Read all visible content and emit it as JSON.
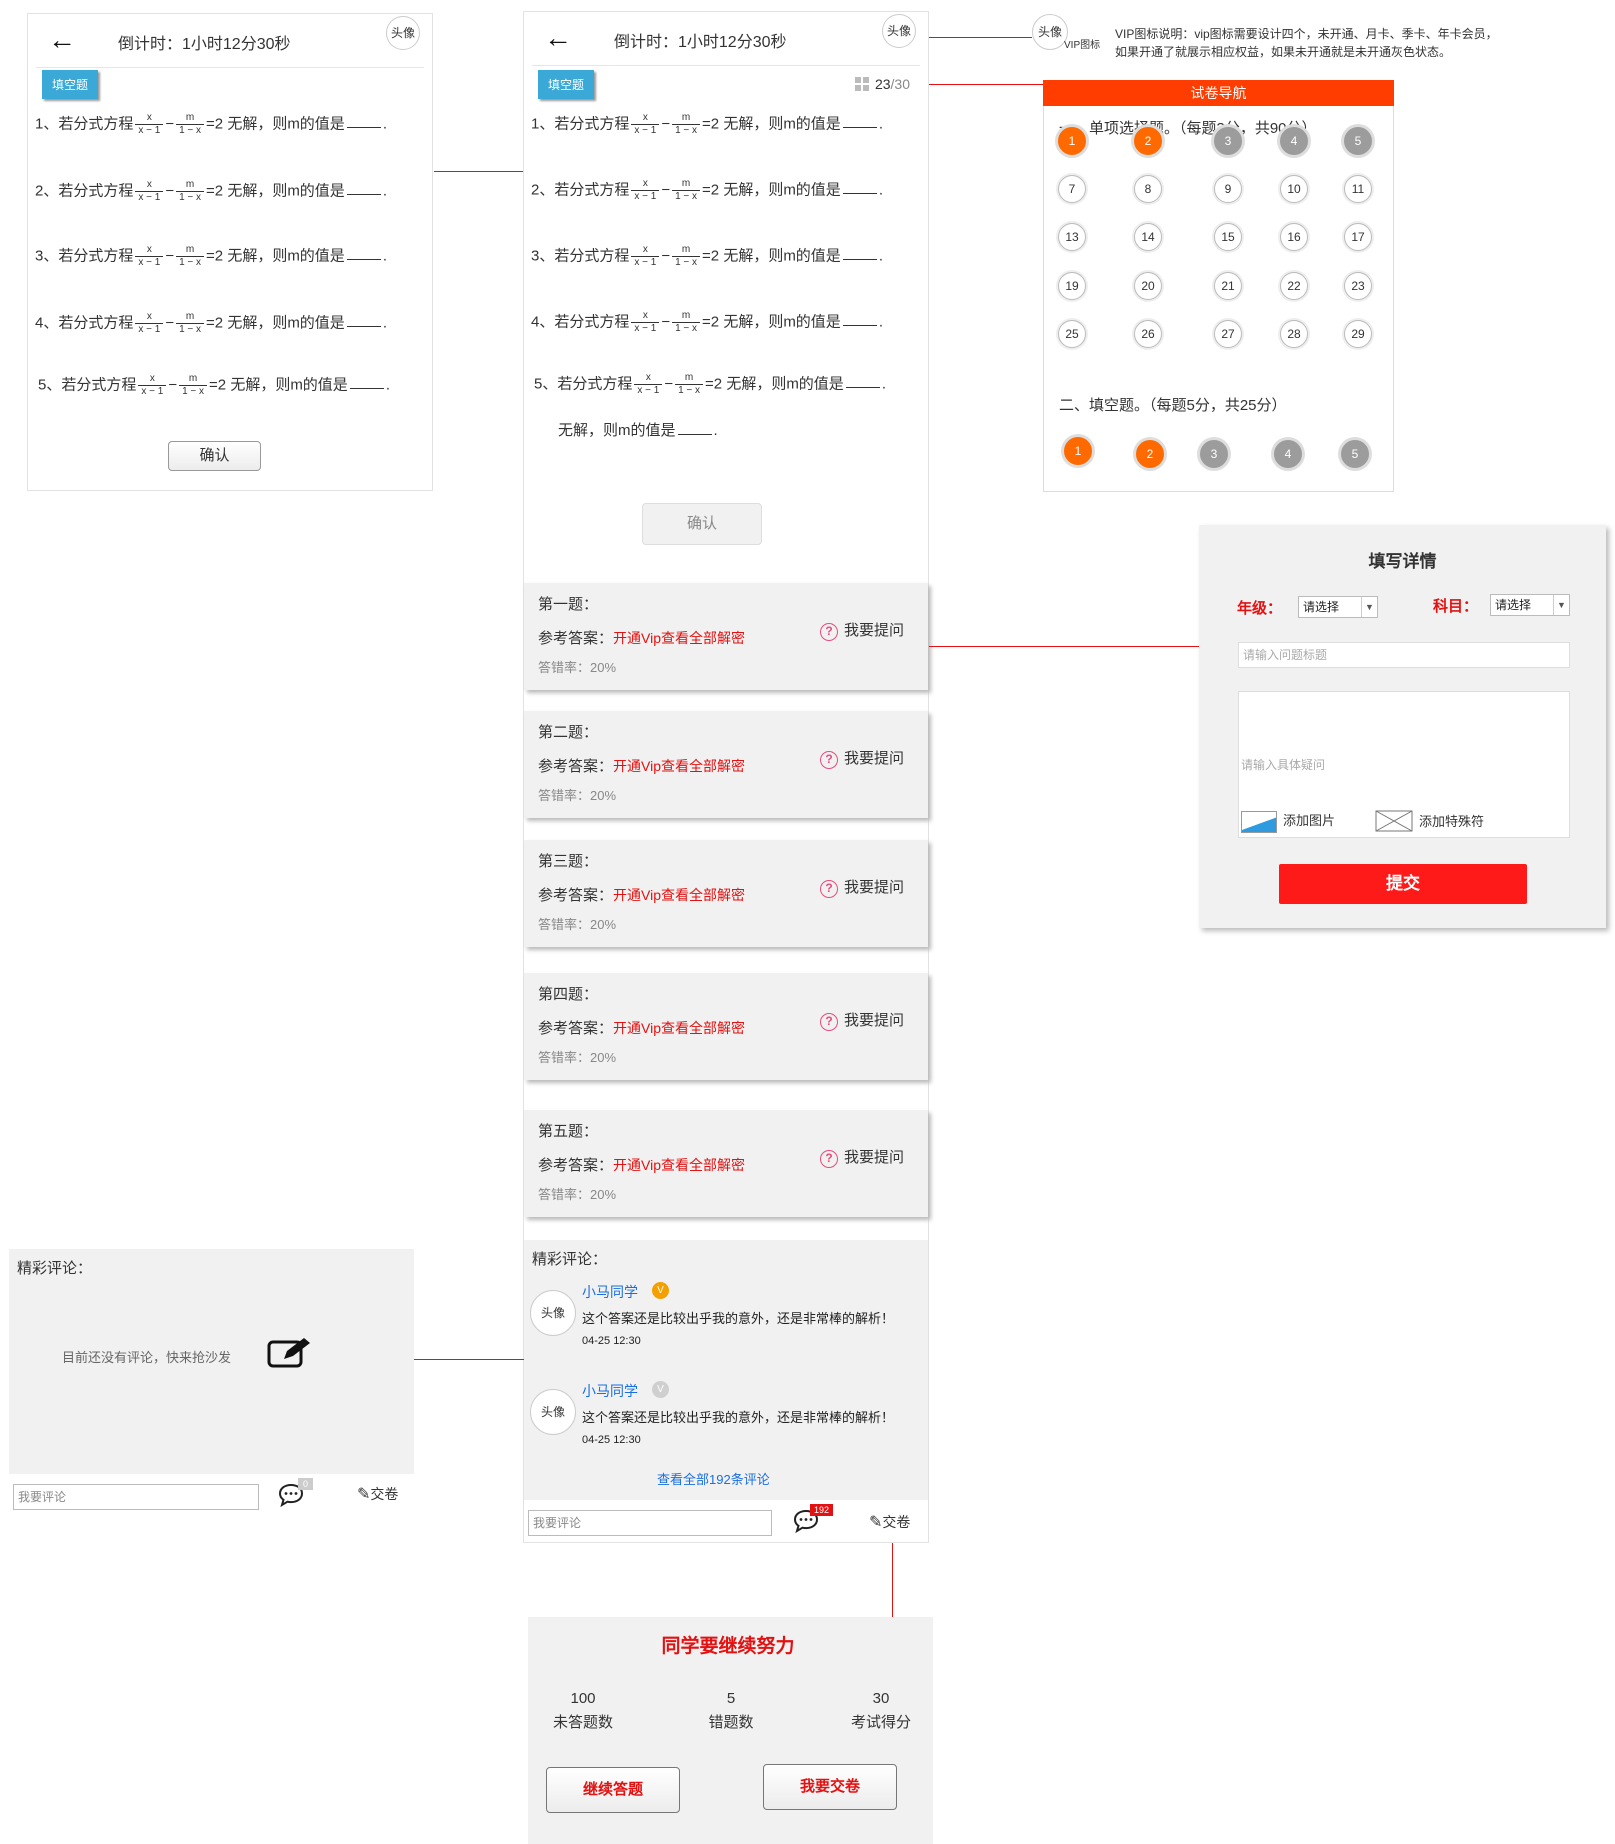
{
  "topbar": {
    "back_icon": "←",
    "countdown": "倒计时：1小时12分30秒",
    "avatar": "头像"
  },
  "tag_fill": "填空题",
  "progress": {
    "current": "23",
    "total": "/30"
  },
  "questions": [
    {
      "num": "1、若分式方程",
      "f1n": "x",
      "f1d": "x − 1",
      "f2n": "m",
      "f2d": "1 − x",
      "tail": "=2  无解，则m的值是",
      "dot": "."
    },
    {
      "num": "2、若分式方程",
      "f1n": "x",
      "f1d": "x − 1",
      "f2n": "m",
      "f2d": "1 − x",
      "tail": "=2  无解，则m的值是",
      "dot": "."
    },
    {
      "num": "3、若分式方程",
      "f1n": "x",
      "f1d": "x − 1",
      "f2n": "m",
      "f2d": "1 − x",
      "tail": "=2  无解，则m的值是",
      "dot": "."
    },
    {
      "num": "4、若分式方程",
      "f1n": "x",
      "f1d": "x − 1",
      "f2n": "m",
      "f2d": "1 − x",
      "tail": "=2  无解，则m的值是",
      "dot": "."
    },
    {
      "num": "5、若分式方程",
      "f1n": "x",
      "f1d": "x − 1",
      "f2n": "m",
      "f2d": "1 − x",
      "tail": "=2  无解，则m的值是",
      "dot": "."
    }
  ],
  "minus": "−",
  "extra_line": "无解，则m的值是",
  "confirm": "确认",
  "answers": [
    {
      "title": "第一题：",
      "ref": "参考答案：",
      "link": "开通Vip查看全部解密",
      "rate": "答错率：20%",
      "ask": "我要提问"
    },
    {
      "title": "第二题：",
      "ref": "参考答案：",
      "link": "开通Vip查看全部解密",
      "rate": "答错率：20%",
      "ask": "我要提问"
    },
    {
      "title": "第三题：",
      "ref": "参考答案：",
      "link": "开通Vip查看全部解密",
      "rate": "答错率：20%",
      "ask": "我要提问"
    },
    {
      "title": "第四题：",
      "ref": "参考答案：",
      "link": "开通Vip查看全部解密",
      "rate": "答错率：20%",
      "ask": "我要提问"
    },
    {
      "title": "第五题：",
      "ref": "参考答案：",
      "link": "开通Vip查看全部解密",
      "rate": "答错率：20%",
      "ask": "我要提问"
    }
  ],
  "qm_icon": "?",
  "comments": {
    "title": "精彩评论：",
    "items": [
      {
        "avatar": "头像",
        "name": "小马同学",
        "vip": "V",
        "text": "这个答案还是比较出乎我的意外，还是非常棒的解析！",
        "time": "04-25 12:30"
      },
      {
        "avatar": "头像",
        "name": "小马同学",
        "vip": "V",
        "text": "这个答案还是比较出乎我的意外，还是非常棒的解析！",
        "time": "04-25 12:30"
      }
    ],
    "view_all": "查看全部192条评论",
    "empty_text": "目前还没有评论，快来抢沙发"
  },
  "bottombar": {
    "placeholder": "我要评论",
    "count": "192",
    "count_empty": "0",
    "submit": "交卷"
  },
  "vip_note": {
    "avatar": "头像",
    "icon_label": "VIP图标",
    "line1": "VIP图标说明：vip图标需要设计四个，未开通、月卡、季卡、年卡会员，",
    "line2": "如果开通了就展示相应权益，如果未开通就是未开通灰色状态。"
  },
  "nav": {
    "header": "试卷导航",
    "section1": "一、单项选择题。（每题3分，共90分）",
    "section2": "二、填空题。（每题5分，共25分）",
    "s1": [
      [
        "1",
        "o"
      ],
      [
        "2",
        "o"
      ],
      [
        "3",
        "g"
      ],
      [
        "4",
        "g"
      ],
      [
        "5",
        "g"
      ],
      [
        "7",
        "w"
      ],
      [
        "8",
        "w"
      ],
      [
        "9",
        "w"
      ],
      [
        "10",
        "w"
      ],
      [
        "11",
        "w"
      ],
      [
        "13",
        "w"
      ],
      [
        "14",
        "w"
      ],
      [
        "15",
        "w"
      ],
      [
        "16",
        "w"
      ],
      [
        "17",
        "w"
      ],
      [
        "19",
        "w"
      ],
      [
        "20",
        "w"
      ],
      [
        "21",
        "w"
      ],
      [
        "22",
        "w"
      ],
      [
        "23",
        "w"
      ],
      [
        "25",
        "w"
      ],
      [
        "26",
        "w"
      ],
      [
        "27",
        "w"
      ],
      [
        "28",
        "w"
      ],
      [
        "29",
        "w"
      ]
    ],
    "s2": [
      [
        "1",
        "o"
      ],
      [
        "2",
        "o"
      ],
      [
        "3",
        "g"
      ],
      [
        "4",
        "g"
      ],
      [
        "5",
        "g"
      ]
    ]
  },
  "form": {
    "title": "填写详情",
    "grade_label": "年级：",
    "subject_label": "科目：",
    "select_value": "请选择",
    "title_placeholder": "请输入问题标题",
    "body_placeholder": "请输入具体疑问",
    "add_image": "添加图片",
    "add_symbol": "添加特殊符",
    "submit": "提交"
  },
  "result": {
    "title": "同学要继续努力",
    "stats": [
      {
        "value": "100",
        "label": "未答题数"
      },
      {
        "value": "5",
        "label": "错题数"
      },
      {
        "value": "30",
        "label": "考试得分"
      }
    ],
    "continue": "继续答题",
    "hand_in": "我要交卷"
  }
}
